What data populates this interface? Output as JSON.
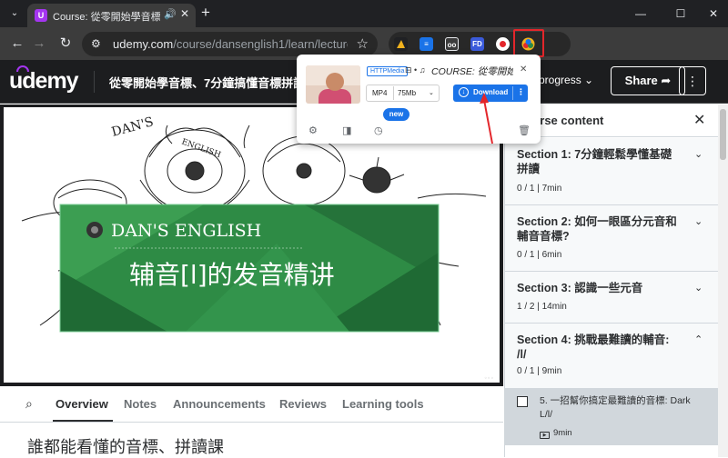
{
  "browser": {
    "tab_title": "Course: 從零開始學音標、",
    "tab_favicon": "U",
    "new_tab_label": "+",
    "url_host": "udemy.com",
    "url_path": "/course/dansenglish1/learn/lecture/...",
    "window_controls": [
      "minimize",
      "maximize",
      "close"
    ],
    "extensions": [
      {
        "name": "ext-dark-icon",
        "label": "",
        "color": "#202124"
      },
      {
        "name": "ext-blue-icon",
        "label": "",
        "color": "#1a73e8"
      },
      {
        "name": "ext-glasses-icon",
        "label": "",
        "color": "#3c3c3c"
      },
      {
        "name": "ext-fd-icon",
        "label": "FD",
        "color": "#3b5bdb"
      },
      {
        "name": "ext-record-icon",
        "label": "",
        "color": "#ffffff"
      },
      {
        "name": "ext-video-downloader-icon",
        "label": "",
        "color": "#f1b21d"
      }
    ]
  },
  "udemy": {
    "logo": "udemy",
    "course_title": "從零開始學音標、7分鐘搞懂音標拼讀(免費",
    "progress_label": "progress",
    "share_label": "Share",
    "more_label": "⋮"
  },
  "video": {
    "brand": "DAN'S ENGLISH",
    "heading": "辅音[l]的发音精讲",
    "sketch_text": "DAN'S ENGLISH"
  },
  "course_tabs": {
    "items": [
      "Overview",
      "Notes",
      "Announcements",
      "Reviews",
      "Learning tools"
    ],
    "active": "Overview"
  },
  "overview": {
    "heading": "誰都能看懂的音標、拼讀課"
  },
  "sidebar": {
    "title": "Course content",
    "sections": [
      {
        "title": "Section 1: 7分鐘輕鬆學懂基礎拼讀",
        "meta": "0 / 1 | 7min",
        "expanded": false
      },
      {
        "title": "Section 2: 如何一眼區分元音和輔音音標?",
        "meta": "0 / 1 | 6min",
        "expanded": false
      },
      {
        "title": "Section 3: 認識一些元音",
        "meta": "1 / 2 | 14min",
        "expanded": false
      },
      {
        "title": "Section 4: 挑戰最難讀的輔音: /l/",
        "meta": "0 / 1 | 9min",
        "expanded": true
      }
    ],
    "lecture": {
      "title": "5. 一招幫你搞定最難讀的音標: Dark L/l/",
      "duration": "9min"
    }
  },
  "popup": {
    "badge": "HTTPMedia",
    "media_icons": "⊟ • ♫",
    "name": "COURSE: 從零開始...",
    "format": "MP4",
    "size": "75Mb",
    "download_label": "Download",
    "new_label": "new"
  },
  "colors": {
    "accent_purple": "#a435f0",
    "download_blue": "#1a73e8",
    "highlight_red": "#e3262b",
    "banner_green": "#2e8b45"
  }
}
